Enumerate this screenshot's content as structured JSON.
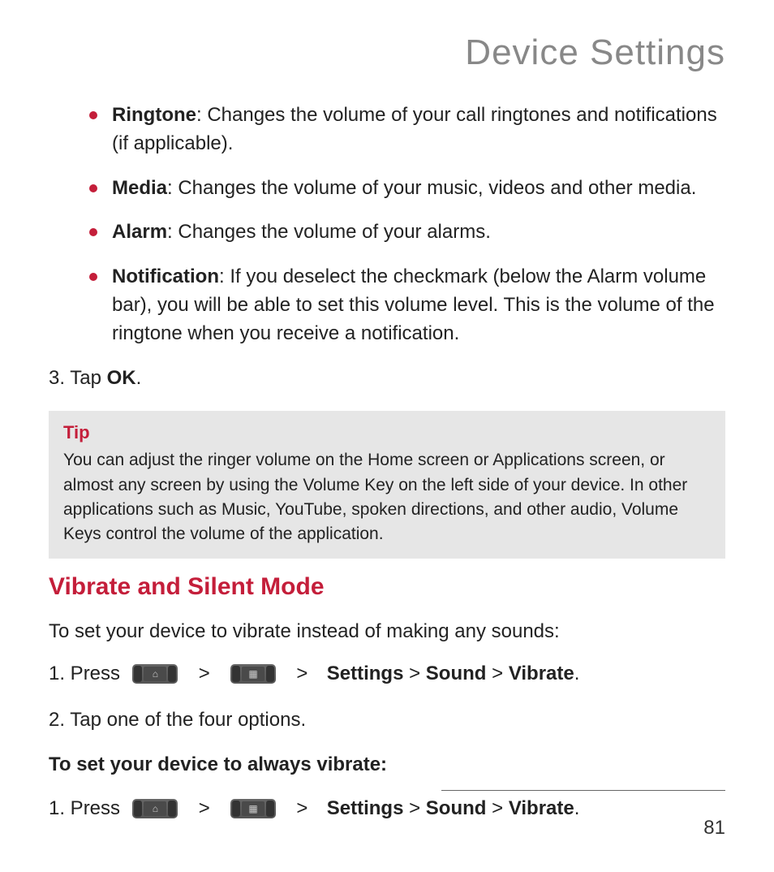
{
  "title": "Device Settings",
  "bullets": [
    {
      "label": "Ringtone",
      "text": ": Changes the volume of your call ringtones and notifications (if applicable)."
    },
    {
      "label": "Media",
      "text": ": Changes the volume of your music, videos and other media."
    },
    {
      "label": "Alarm",
      "text": ": Changes the volume of your alarms."
    },
    {
      "label": "Notification",
      "text": ": If you deselect the checkmark (below the Alarm volume bar), you will be able to set this volume level. This is the volume of the ringtone when you receive a notification."
    }
  ],
  "step3_prefix": "3. Tap ",
  "step3_bold": "OK",
  "step3_suffix": ".",
  "tip": {
    "title": "Tip",
    "text": "You can adjust the ringer volume on the Home screen or Applications screen, or almost any screen by using the Volume Key on the left side of your device. In other applications such as Music, YouTube, spoken directions, and other audio, Volume Keys control the volume of the application."
  },
  "section_heading": "Vibrate and Silent Mode",
  "intro": "To set your device to vibrate instead of making any sounds:",
  "vibrate_steps": {
    "s1_prefix": "1. Press  ",
    "gt": "  >  ",
    "path_settings": "Settings",
    "path_sep": " > ",
    "path_sound": "Sound",
    "path_vibrate": "Vibrate",
    "path_end": ".",
    "s2": "2. Tap one of the four options."
  },
  "subheading": "To set your device to always vibrate:",
  "always_steps": {
    "s1_prefix": "1. Press  "
  },
  "icons": {
    "home": "⌂",
    "apps": "▦"
  },
  "page_number": "81"
}
